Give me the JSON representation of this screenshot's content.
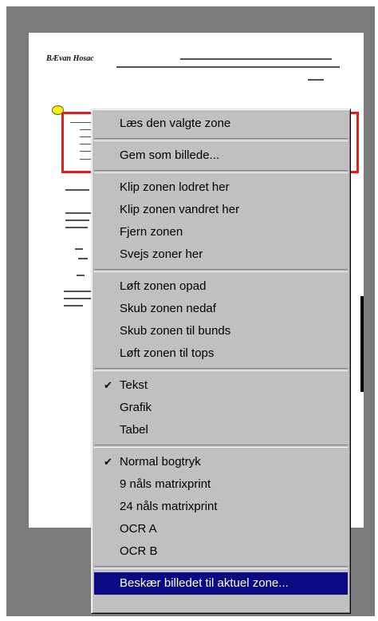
{
  "document": {
    "brand": "BÆvan Hosac"
  },
  "menu": {
    "items": {
      "read_zone": "Læs den valgte zone",
      "save_image": "Gem som billede...",
      "split_vertical": "Klip zonen lodret her",
      "split_horizontal": "Klip zonen vandret her",
      "remove_zone": "Fjern zonen",
      "merge_zones": "Svejs zoner her",
      "lift_up": "Løft zonen opad",
      "push_down": "Skub zonen nedaf",
      "push_bottom": "Skub zonen til bunds",
      "lift_top": "Løft zonen til tops",
      "type_text": "Tekst",
      "type_graphic": "Grafik",
      "type_table": "Tabel",
      "font_normal": "Normal bogtryk",
      "font_9pin": "9 nåls matrixprint",
      "font_24pin": "24 nåls matrixprint",
      "font_ocra": "OCR A",
      "font_ocrb": "OCR B",
      "crop_to_zone": "Beskær billedet til aktuel zone..."
    },
    "check_glyph": "✔",
    "colors": {
      "menu_bg": "#c0c0c0",
      "highlight_bg": "#0a0a84",
      "highlight_fg": "#ffffff",
      "zone_border": "#e21b1b",
      "zone_marker": "#f6ef1c"
    }
  }
}
